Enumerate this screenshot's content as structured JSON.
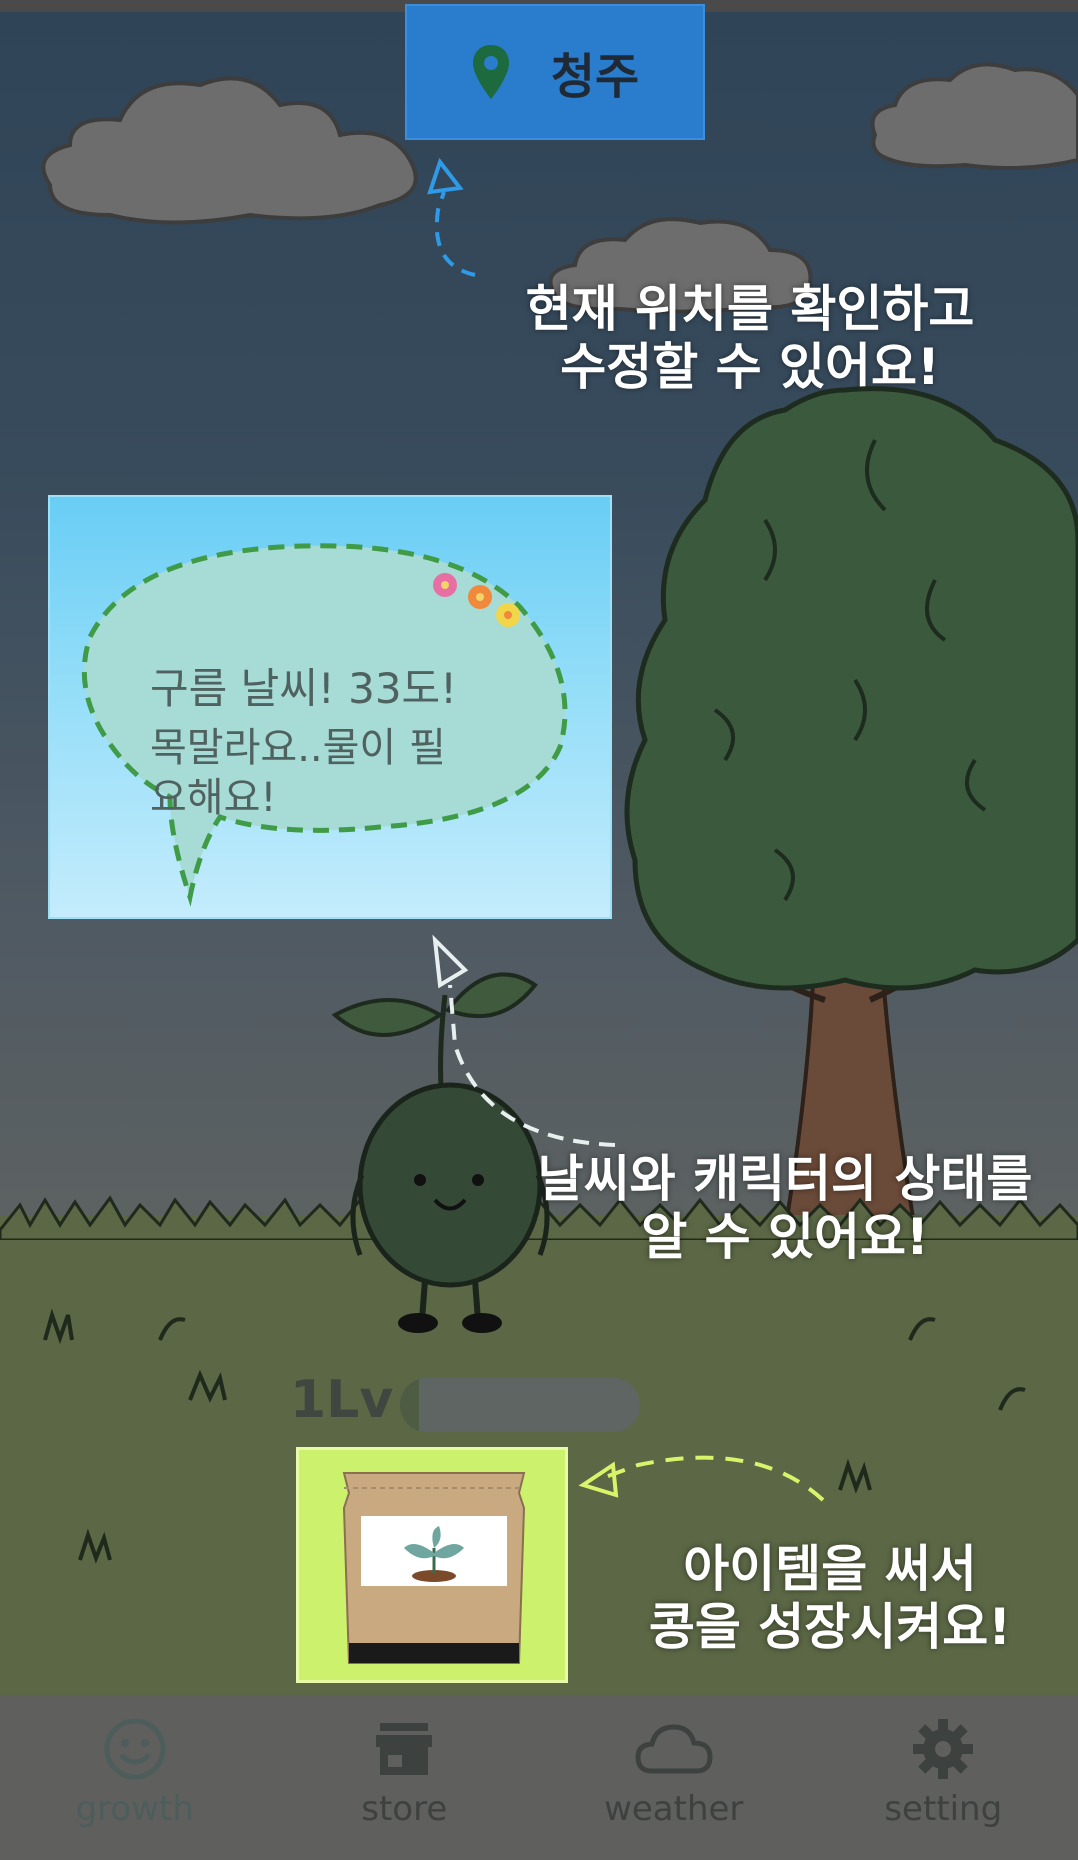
{
  "location": {
    "name": "청주",
    "icon": "map-pin-icon",
    "pin_color": "#1c6a3e"
  },
  "hints": {
    "location": [
      "현재 위치를 확인하고",
      "수정할 수 있어요!"
    ],
    "status": [
      "날씨와 캐릭터의 상태를",
      "알 수 있어요!"
    ],
    "item": [
      "아이템을 써서",
      "콩을 성장시켜요!"
    ]
  },
  "bubble": {
    "line1": "구름 날씨! 33도!",
    "line2": "목말라요..물이 필요해요!"
  },
  "level": {
    "label": "1Lv",
    "progress": 0.08
  },
  "item": {
    "icon": "seed-bag-icon"
  },
  "nav": [
    {
      "label": "growth",
      "icon": "smiley-icon",
      "active": true
    },
    {
      "label": "store",
      "icon": "store-icon",
      "active": false
    },
    {
      "label": "weather",
      "icon": "cloud-icon",
      "active": false
    },
    {
      "label": "setting",
      "icon": "gear-icon",
      "active": false
    }
  ],
  "colors": {
    "sky_top": "#2f4457",
    "grass": "#5b6745",
    "location_bg": "#2a7ccc",
    "item_bg": "#cbf16d",
    "nav_bg": "#5f5f5d"
  }
}
